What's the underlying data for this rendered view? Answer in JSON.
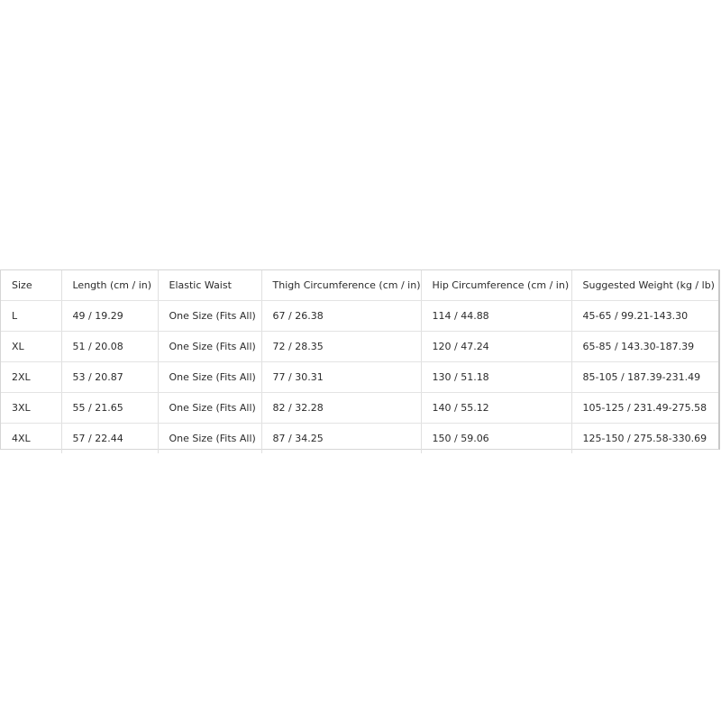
{
  "size_chart": {
    "headers": [
      "Size",
      "Length (cm / in)",
      "Elastic Waist",
      "Thigh Circumference (cm / in)",
      "Hip Circumference (cm / in)",
      "Suggested Weight (kg / lb)"
    ],
    "rows": [
      [
        "L",
        "49 / 19.29",
        "One Size (Fits All)",
        "67 / 26.38",
        "114 / 44.88",
        "45-65 / 99.21-143.30"
      ],
      [
        "XL",
        "51 / 20.08",
        "One Size (Fits All)",
        "72 / 28.35",
        "120 / 47.24",
        "65-85 / 143.30-187.39"
      ],
      [
        "2XL",
        "53 / 20.87",
        "One Size (Fits All)",
        "77 / 30.31",
        "130 / 51.18",
        "85-105 / 187.39-231.49"
      ],
      [
        "3XL",
        "55 / 21.65",
        "One Size (Fits All)",
        "82 / 32.28",
        "140 / 55.12",
        "105-125 / 231.49-275.58"
      ],
      [
        "4XL",
        "57 / 22.44",
        "One Size (Fits All)",
        "87 / 34.25",
        "150 / 59.06",
        "125-150 / 275.58-330.69"
      ]
    ]
  }
}
